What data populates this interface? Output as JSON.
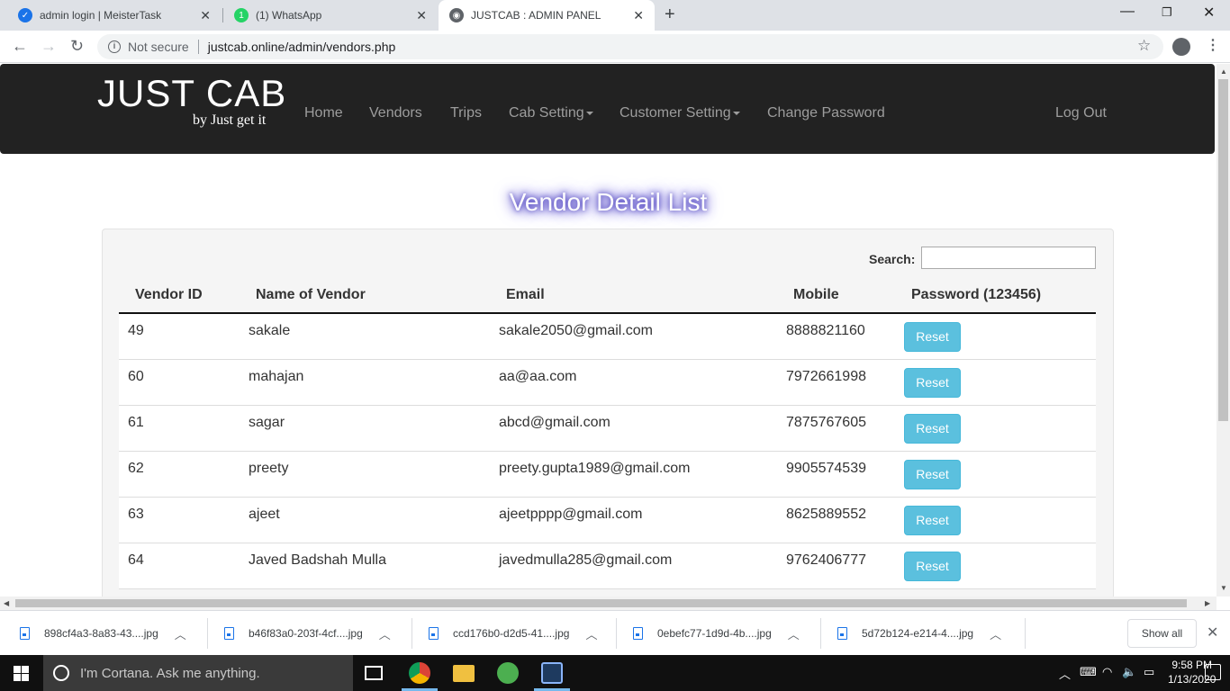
{
  "browser": {
    "tabs": [
      {
        "title": "admin login | MeisterTask",
        "active": false
      },
      {
        "title": "(1) WhatsApp",
        "active": false
      },
      {
        "title": "JUSTCAB : ADMIN PANEL",
        "active": true
      }
    ],
    "address": {
      "security": "Not secure",
      "url": "justcab.online/admin/vendors.php"
    }
  },
  "site": {
    "logo_main": "JUST CAB",
    "logo_tagline": "by Just get it",
    "nav": {
      "home": "Home",
      "vendors": "Vendors",
      "trips": "Trips",
      "cab_setting": "Cab Setting",
      "customer_setting": "Customer Setting",
      "change_password": "Change Password",
      "logout": "Log Out"
    }
  },
  "main": {
    "title": "Vendor Detail List",
    "search_label": "Search:",
    "columns": [
      "Vendor ID",
      "Name of Vendor",
      "Email",
      "Mobile",
      "Password (123456)"
    ],
    "rows": [
      {
        "id": "49",
        "name": "sakale",
        "email": "sakale2050@gmail.com",
        "mobile": "8888821160",
        "action": "Reset"
      },
      {
        "id": "60",
        "name": "mahajan",
        "email": "aa@aa.com",
        "mobile": "7972661998",
        "action": "Reset"
      },
      {
        "id": "61",
        "name": "sagar",
        "email": "abcd@gmail.com",
        "mobile": "7875767605",
        "action": "Reset"
      },
      {
        "id": "62",
        "name": "preety",
        "email": "preety.gupta1989@gmail.com",
        "mobile": "9905574539",
        "action": "Reset"
      },
      {
        "id": "63",
        "name": "ajeet",
        "email": "ajeetpppp@gmail.com",
        "mobile": "8625889552",
        "action": "Reset"
      },
      {
        "id": "64",
        "name": "Javed Badshah Mulla",
        "email": "javedmulla285@gmail.com",
        "mobile": "9762406777",
        "action": "Reset"
      }
    ]
  },
  "downloads": {
    "items": [
      "898cf4a3-8a83-43....jpg",
      "b46f83a0-203f-4cf....jpg",
      "ccd176b0-d2d5-41....jpg",
      "0ebefc77-1d9d-4b....jpg",
      "5d72b124-e214-4....jpg"
    ],
    "show_all": "Show all"
  },
  "taskbar": {
    "search_placeholder": "I'm Cortana. Ask me anything.",
    "time": "9:58 PM",
    "date": "1/13/2020"
  },
  "colors": {
    "navbar": "#222222",
    "reset_button": "#5bc0de",
    "title_glow": "#3b2fb8"
  }
}
